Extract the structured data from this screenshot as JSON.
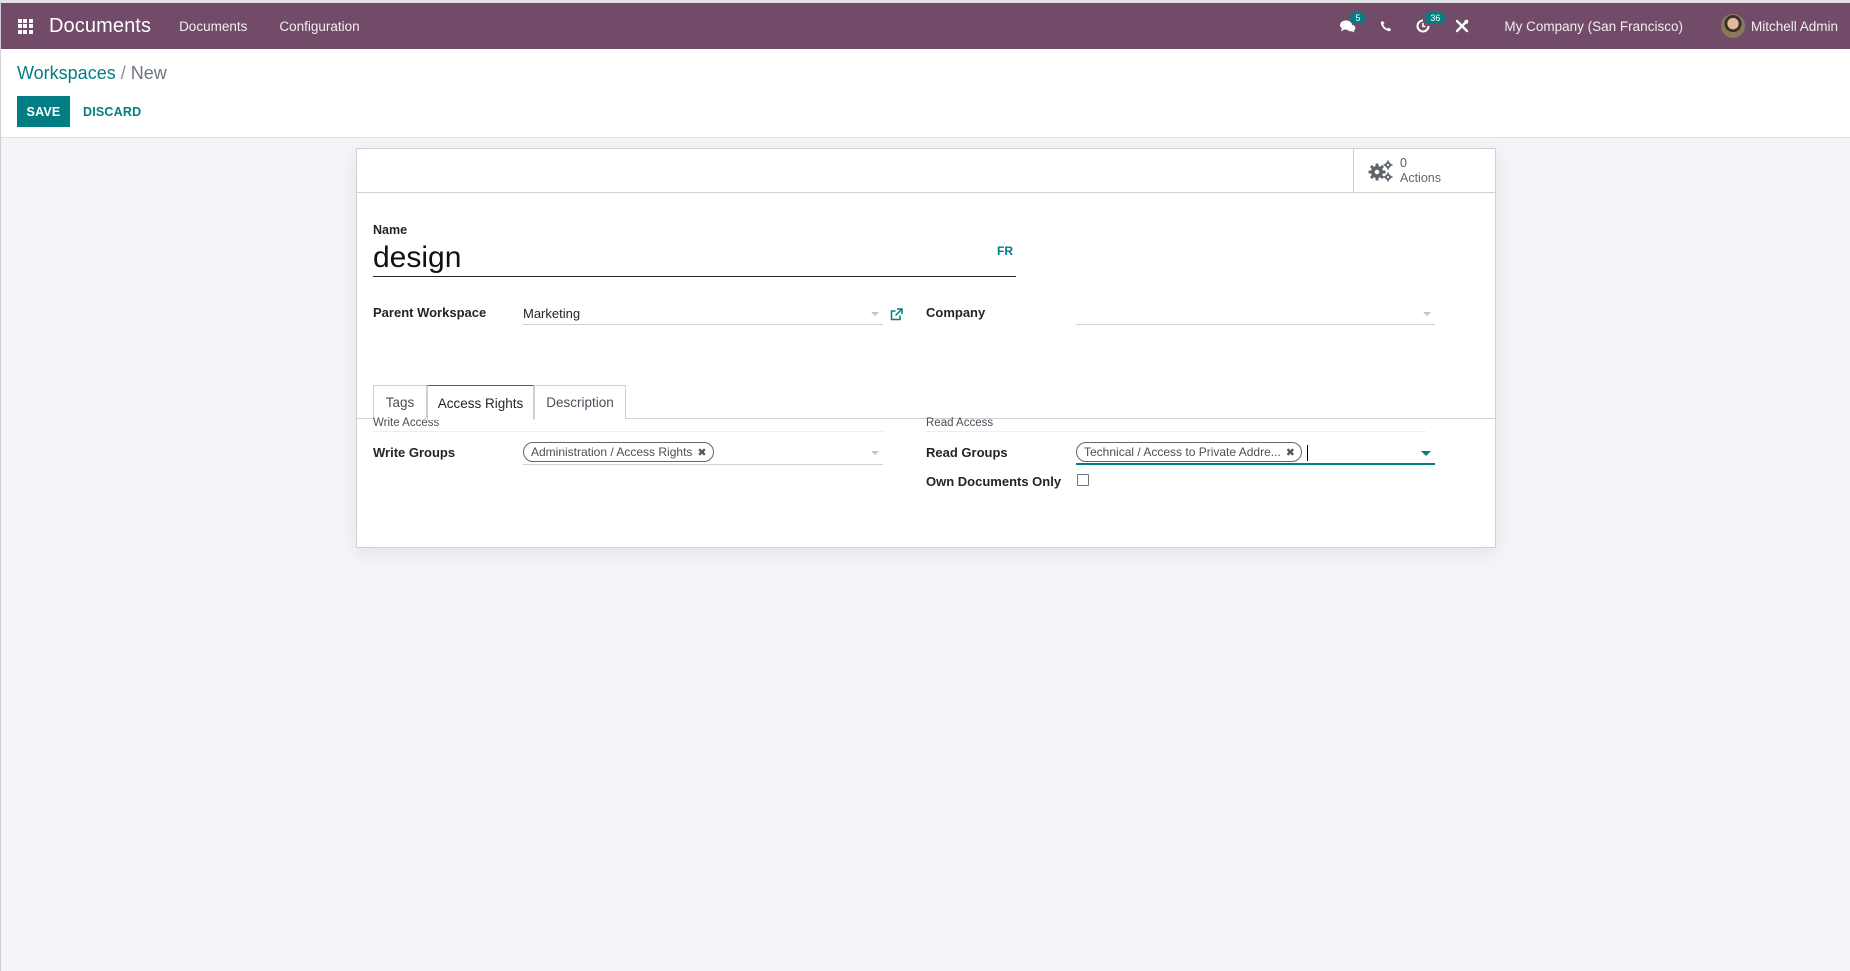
{
  "navbar": {
    "app_name": "Documents",
    "menus": [
      "Documents",
      "Configuration"
    ],
    "systray": {
      "messages_icon": "chat-bubbles-icon",
      "messages_count": "5",
      "phone_icon": "phone-icon",
      "activities_icon": "clock-icon",
      "activities_count": "36",
      "debug_icon": "tools-icon"
    },
    "company": "My Company (San Francisco)",
    "user": "Mitchell Admin"
  },
  "control_panel": {
    "breadcrumb_parent": "Workspaces",
    "breadcrumb_separator": "/",
    "breadcrumb_current": "New",
    "save_label": "SAVE",
    "discard_label": "DISCARD"
  },
  "form": {
    "stat_button": {
      "value": "0",
      "label": "Actions",
      "icon": "gears-icon"
    },
    "name_label": "Name",
    "name_value": "design",
    "lang_button": "FR",
    "parent_workspace_label": "Parent Workspace",
    "parent_workspace_value": "Marketing",
    "company_label": "Company",
    "company_value": "",
    "tabs": [
      {
        "label": "Tags",
        "active": false
      },
      {
        "label": "Access Rights",
        "active": true
      },
      {
        "label": "Description",
        "active": false
      }
    ],
    "write_access": {
      "title": "Write Access",
      "groups_label": "Write Groups",
      "groups": [
        "Administration / Access Rights"
      ]
    },
    "read_access": {
      "title": "Read Access",
      "groups_label": "Read Groups",
      "groups": [
        "Technical / Access to Private Addre..."
      ],
      "own_documents_label": "Own Documents Only",
      "own_documents_checked": false
    }
  },
  "colors": {
    "navbar": "#714b67",
    "primary": "#017e84",
    "background": "#f4f5f8"
  }
}
